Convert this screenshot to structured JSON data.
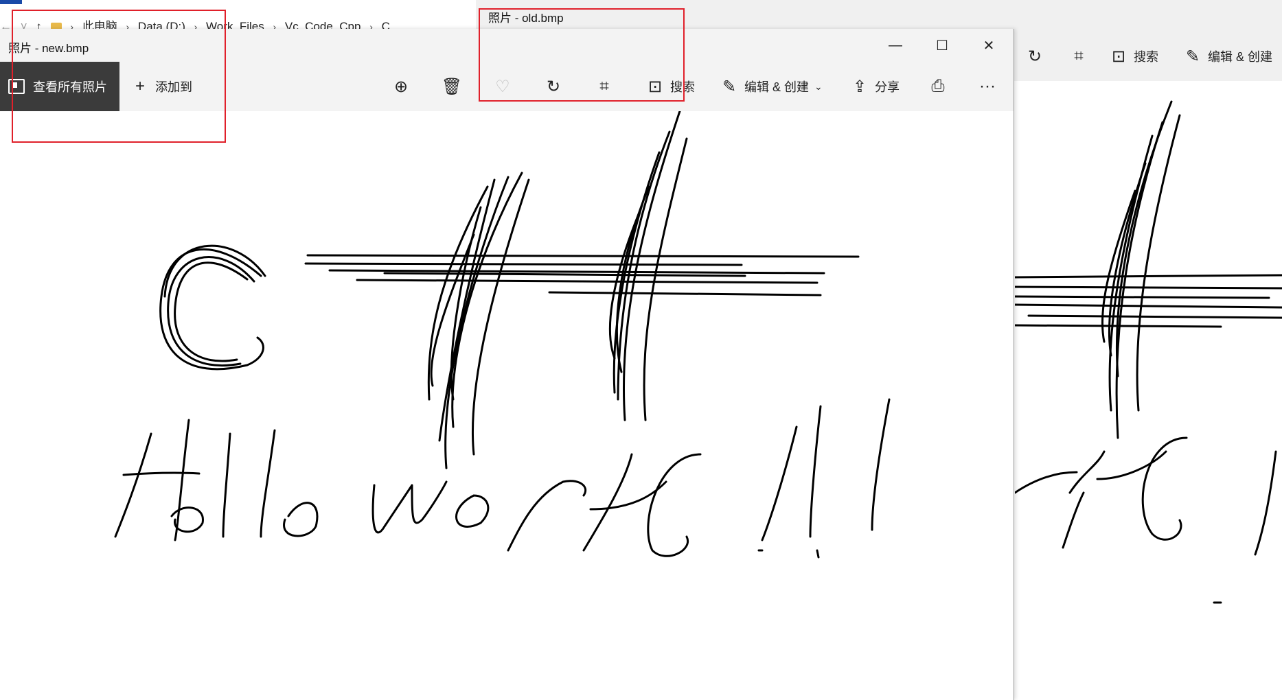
{
  "explorer": {
    "nav": [
      "←",
      "˅",
      "↑"
    ],
    "breadcrumb": [
      "此电脑",
      "Data (D:)",
      "Work_Files",
      "Vc_Code_Cpp",
      "C"
    ]
  },
  "old_window": {
    "title": "照片 - old.bmp",
    "toolbar": {
      "rotate": "rotate-icon",
      "crop": "crop-icon",
      "search_label": "搜索",
      "edit_label": "编辑 & 创建"
    }
  },
  "new_window": {
    "title": "照片 - new.bmp",
    "window_controls": {
      "minimize": "—",
      "maximize": "☐",
      "close": "✕"
    },
    "toolbar": {
      "view_all_label": "查看所有照片",
      "add_to_label": "添加到",
      "zoom": "zoom-in-icon",
      "delete": "trash-icon",
      "favorite": "heart-icon",
      "rotate": "rotate-icon",
      "crop": "crop-icon",
      "search_label": "搜索",
      "edit_label": "编辑 & 创建",
      "share_label": "分享",
      "print": "printer-icon",
      "more": "···"
    }
  },
  "colors": {
    "highlight_box": "#e0202a",
    "toolbar_bg": "#f3f3f3",
    "active_button_bg": "#3b3b3b"
  }
}
